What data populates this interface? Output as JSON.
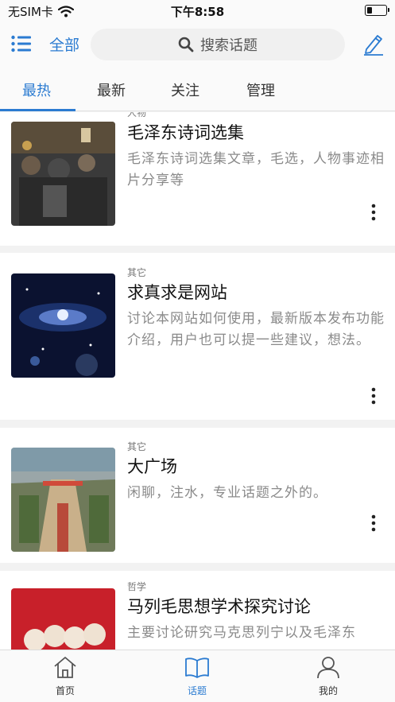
{
  "status_bar": {
    "carrier": "无SIM卡",
    "time": "下午8:58",
    "battery_level": 0.25,
    "wifi_icon": "wifi-icon",
    "battery_icon": "battery-icon"
  },
  "nav": {
    "all_label": "全部",
    "search_placeholder": "搜索话题",
    "menu_icon": "list-menu-icon",
    "edit_icon": "pencil-edit-icon"
  },
  "tabs": [
    {
      "label": "最热",
      "active": true
    },
    {
      "label": "最新",
      "active": false
    },
    {
      "label": "关注",
      "active": false
    },
    {
      "label": "管理",
      "active": false
    }
  ],
  "topics": [
    {
      "category": "人物",
      "title": "毛泽东诗词选集",
      "description": "毛泽东诗词选集文章，毛选，人物事迹相片分享等"
    },
    {
      "category": "其它",
      "title": "求真求是网站",
      "description": "讨论本网站如何使用，最新版本发布功能介绍，用户也可以提一些建议，想法。"
    },
    {
      "category": "其它",
      "title": "大广场",
      "description": "闲聊，注水，专业话题之外的。"
    },
    {
      "category": "哲学",
      "title": "马列毛思想学术探究讨论",
      "description": "主要讨论研究马克思列宁以及毛泽东"
    }
  ],
  "bottom_tabs": [
    {
      "label": "首页",
      "icon": "home-icon",
      "active": false
    },
    {
      "label": "话题",
      "icon": "open-book-icon",
      "active": true
    },
    {
      "label": "我的",
      "icon": "user-icon",
      "active": false
    }
  ],
  "colors": {
    "accent": "#2b7bd1",
    "background": "#f2f2f2",
    "card": "#ffffff"
  }
}
